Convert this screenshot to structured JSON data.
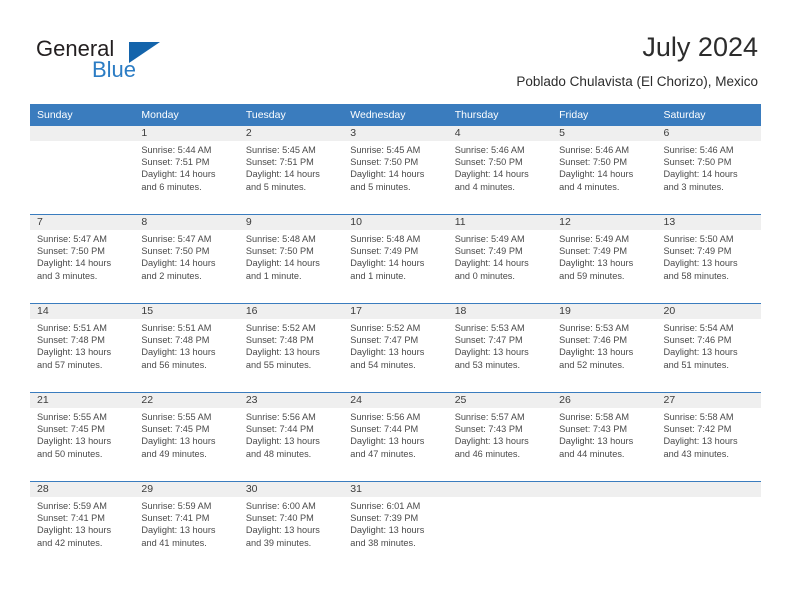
{
  "brand": {
    "name_part1": "General",
    "name_part2": "Blue",
    "flag_icon": "triangle-flag-icon"
  },
  "header": {
    "title": "July 2024",
    "location": "Poblado Chulavista (El Chorizo), Mexico"
  },
  "colors": {
    "header_blue": "#3a7cbe",
    "brand_blue": "#2b7cc4",
    "flag_blue": "#1464ab",
    "daynum_band": "#efefef",
    "text": "#4a4a4a"
  },
  "weekday_headers": [
    "Sunday",
    "Monday",
    "Tuesday",
    "Wednesday",
    "Thursday",
    "Friday",
    "Saturday"
  ],
  "weeks": [
    [
      {
        "day": "",
        "lines": []
      },
      {
        "day": "1",
        "lines": [
          "Sunrise: 5:44 AM",
          "Sunset: 7:51 PM",
          "Daylight: 14 hours",
          "and 6 minutes."
        ]
      },
      {
        "day": "2",
        "lines": [
          "Sunrise: 5:45 AM",
          "Sunset: 7:51 PM",
          "Daylight: 14 hours",
          "and 5 minutes."
        ]
      },
      {
        "day": "3",
        "lines": [
          "Sunrise: 5:45 AM",
          "Sunset: 7:50 PM",
          "Daylight: 14 hours",
          "and 5 minutes."
        ]
      },
      {
        "day": "4",
        "lines": [
          "Sunrise: 5:46 AM",
          "Sunset: 7:50 PM",
          "Daylight: 14 hours",
          "and 4 minutes."
        ]
      },
      {
        "day": "5",
        "lines": [
          "Sunrise: 5:46 AM",
          "Sunset: 7:50 PM",
          "Daylight: 14 hours",
          "and 4 minutes."
        ]
      },
      {
        "day": "6",
        "lines": [
          "Sunrise: 5:46 AM",
          "Sunset: 7:50 PM",
          "Daylight: 14 hours",
          "and 3 minutes."
        ]
      }
    ],
    [
      {
        "day": "7",
        "lines": [
          "Sunrise: 5:47 AM",
          "Sunset: 7:50 PM",
          "Daylight: 14 hours",
          "and 3 minutes."
        ]
      },
      {
        "day": "8",
        "lines": [
          "Sunrise: 5:47 AM",
          "Sunset: 7:50 PM",
          "Daylight: 14 hours",
          "and 2 minutes."
        ]
      },
      {
        "day": "9",
        "lines": [
          "Sunrise: 5:48 AM",
          "Sunset: 7:50 PM",
          "Daylight: 14 hours",
          "and 1 minute."
        ]
      },
      {
        "day": "10",
        "lines": [
          "Sunrise: 5:48 AM",
          "Sunset: 7:49 PM",
          "Daylight: 14 hours",
          "and 1 minute."
        ]
      },
      {
        "day": "11",
        "lines": [
          "Sunrise: 5:49 AM",
          "Sunset: 7:49 PM",
          "Daylight: 14 hours",
          "and 0 minutes."
        ]
      },
      {
        "day": "12",
        "lines": [
          "Sunrise: 5:49 AM",
          "Sunset: 7:49 PM",
          "Daylight: 13 hours",
          "and 59 minutes."
        ]
      },
      {
        "day": "13",
        "lines": [
          "Sunrise: 5:50 AM",
          "Sunset: 7:49 PM",
          "Daylight: 13 hours",
          "and 58 minutes."
        ]
      }
    ],
    [
      {
        "day": "14",
        "lines": [
          "Sunrise: 5:51 AM",
          "Sunset: 7:48 PM",
          "Daylight: 13 hours",
          "and 57 minutes."
        ]
      },
      {
        "day": "15",
        "lines": [
          "Sunrise: 5:51 AM",
          "Sunset: 7:48 PM",
          "Daylight: 13 hours",
          "and 56 minutes."
        ]
      },
      {
        "day": "16",
        "lines": [
          "Sunrise: 5:52 AM",
          "Sunset: 7:48 PM",
          "Daylight: 13 hours",
          "and 55 minutes."
        ]
      },
      {
        "day": "17",
        "lines": [
          "Sunrise: 5:52 AM",
          "Sunset: 7:47 PM",
          "Daylight: 13 hours",
          "and 54 minutes."
        ]
      },
      {
        "day": "18",
        "lines": [
          "Sunrise: 5:53 AM",
          "Sunset: 7:47 PM",
          "Daylight: 13 hours",
          "and 53 minutes."
        ]
      },
      {
        "day": "19",
        "lines": [
          "Sunrise: 5:53 AM",
          "Sunset: 7:46 PM",
          "Daylight: 13 hours",
          "and 52 minutes."
        ]
      },
      {
        "day": "20",
        "lines": [
          "Sunrise: 5:54 AM",
          "Sunset: 7:46 PM",
          "Daylight: 13 hours",
          "and 51 minutes."
        ]
      }
    ],
    [
      {
        "day": "21",
        "lines": [
          "Sunrise: 5:55 AM",
          "Sunset: 7:45 PM",
          "Daylight: 13 hours",
          "and 50 minutes."
        ]
      },
      {
        "day": "22",
        "lines": [
          "Sunrise: 5:55 AM",
          "Sunset: 7:45 PM",
          "Daylight: 13 hours",
          "and 49 minutes."
        ]
      },
      {
        "day": "23",
        "lines": [
          "Sunrise: 5:56 AM",
          "Sunset: 7:44 PM",
          "Daylight: 13 hours",
          "and 48 minutes."
        ]
      },
      {
        "day": "24",
        "lines": [
          "Sunrise: 5:56 AM",
          "Sunset: 7:44 PM",
          "Daylight: 13 hours",
          "and 47 minutes."
        ]
      },
      {
        "day": "25",
        "lines": [
          "Sunrise: 5:57 AM",
          "Sunset: 7:43 PM",
          "Daylight: 13 hours",
          "and 46 minutes."
        ]
      },
      {
        "day": "26",
        "lines": [
          "Sunrise: 5:58 AM",
          "Sunset: 7:43 PM",
          "Daylight: 13 hours",
          "and 44 minutes."
        ]
      },
      {
        "day": "27",
        "lines": [
          "Sunrise: 5:58 AM",
          "Sunset: 7:42 PM",
          "Daylight: 13 hours",
          "and 43 minutes."
        ]
      }
    ],
    [
      {
        "day": "28",
        "lines": [
          "Sunrise: 5:59 AM",
          "Sunset: 7:41 PM",
          "Daylight: 13 hours",
          "and 42 minutes."
        ]
      },
      {
        "day": "29",
        "lines": [
          "Sunrise: 5:59 AM",
          "Sunset: 7:41 PM",
          "Daylight: 13 hours",
          "and 41 minutes."
        ]
      },
      {
        "day": "30",
        "lines": [
          "Sunrise: 6:00 AM",
          "Sunset: 7:40 PM",
          "Daylight: 13 hours",
          "and 39 minutes."
        ]
      },
      {
        "day": "31",
        "lines": [
          "Sunrise: 6:01 AM",
          "Sunset: 7:39 PM",
          "Daylight: 13 hours",
          "and 38 minutes."
        ]
      },
      {
        "day": "",
        "lines": []
      },
      {
        "day": "",
        "lines": []
      },
      {
        "day": "",
        "lines": []
      }
    ]
  ]
}
